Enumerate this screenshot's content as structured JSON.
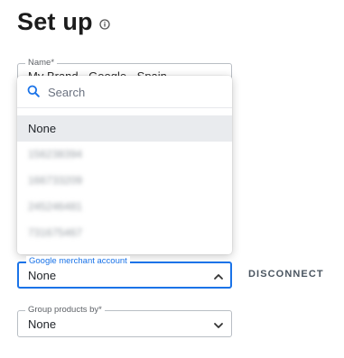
{
  "page": {
    "title": "Set up"
  },
  "name_field": {
    "label": "Name*",
    "value": "My Brand - Google - Spain"
  },
  "dropdown": {
    "search_placeholder": "Search",
    "options": [
      "None",
      "156238394",
      "166733209",
      "245246481",
      "731675467"
    ],
    "selected": "None"
  },
  "merchant_field": {
    "label": "Google merchant account",
    "value": "None"
  },
  "disconnect_label": "DISCONNECT",
  "group_field": {
    "label": "Group products by*",
    "value": "None"
  },
  "colors": {
    "accent": "#1a73e8",
    "border": "#b9bec4",
    "selected_bg": "#e9ebee"
  }
}
